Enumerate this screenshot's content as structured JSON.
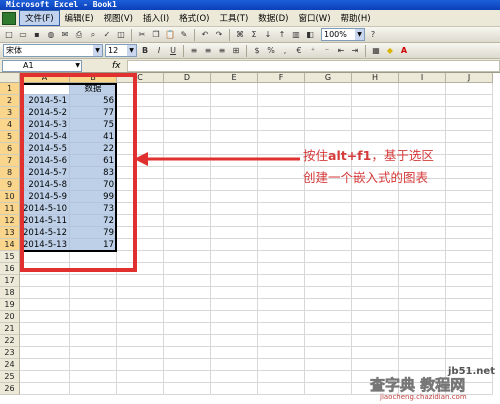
{
  "window": {
    "title": "Microsoft Excel - Book1"
  },
  "menu": [
    "文件(F)",
    "编辑(E)",
    "视图(V)",
    "插入(I)",
    "格式(O)",
    "工具(T)",
    "数据(D)",
    "窗口(W)",
    "帮助(H)"
  ],
  "toolbar": {
    "zoom": "100%",
    "font_name": "宋体",
    "font_size": "12"
  },
  "name_box": "A1",
  "fx_label": "fx",
  "columns": [
    "A",
    "B",
    "C",
    "D",
    "E",
    "F",
    "G",
    "H",
    "I",
    "J"
  ],
  "rows": [
    "1",
    "2",
    "3",
    "4",
    "5",
    "6",
    "7",
    "8",
    "9",
    "10",
    "11",
    "12",
    "13",
    "14",
    "15",
    "16",
    "17",
    "18",
    "19",
    "20",
    "21",
    "22",
    "23",
    "24",
    "25",
    "26"
  ],
  "sheet": {
    "header_label": "数据",
    "data": [
      {
        "date": "2014-5-1",
        "value": "56"
      },
      {
        "date": "2014-5-2",
        "value": "77"
      },
      {
        "date": "2014-5-3",
        "value": "75"
      },
      {
        "date": "2014-5-4",
        "value": "41"
      },
      {
        "date": "2014-5-5",
        "value": "22"
      },
      {
        "date": "2014-5-6",
        "value": "61"
      },
      {
        "date": "2014-5-7",
        "value": "83"
      },
      {
        "date": "2014-5-8",
        "value": "70"
      },
      {
        "date": "2014-5-9",
        "value": "99"
      },
      {
        "date": "2014-5-10",
        "value": "73"
      },
      {
        "date": "2014-5-11",
        "value": "72"
      },
      {
        "date": "2014-5-12",
        "value": "79"
      },
      {
        "date": "2014-5-13",
        "value": "17"
      }
    ]
  },
  "annotation": {
    "line1_pre": "按住",
    "line1_bold": "alt+f1",
    "line1_post": "，基于选区",
    "line2": "创建一个嵌入式的图表"
  },
  "watermark": {
    "site": "jb51.net",
    "text": "查字典 教程网",
    "url": "jiaocheng.chazidian.com"
  },
  "colors": {
    "annotation": "#d63b3b",
    "selection": "#bdd0e8",
    "highlight_border": "#e03030"
  }
}
